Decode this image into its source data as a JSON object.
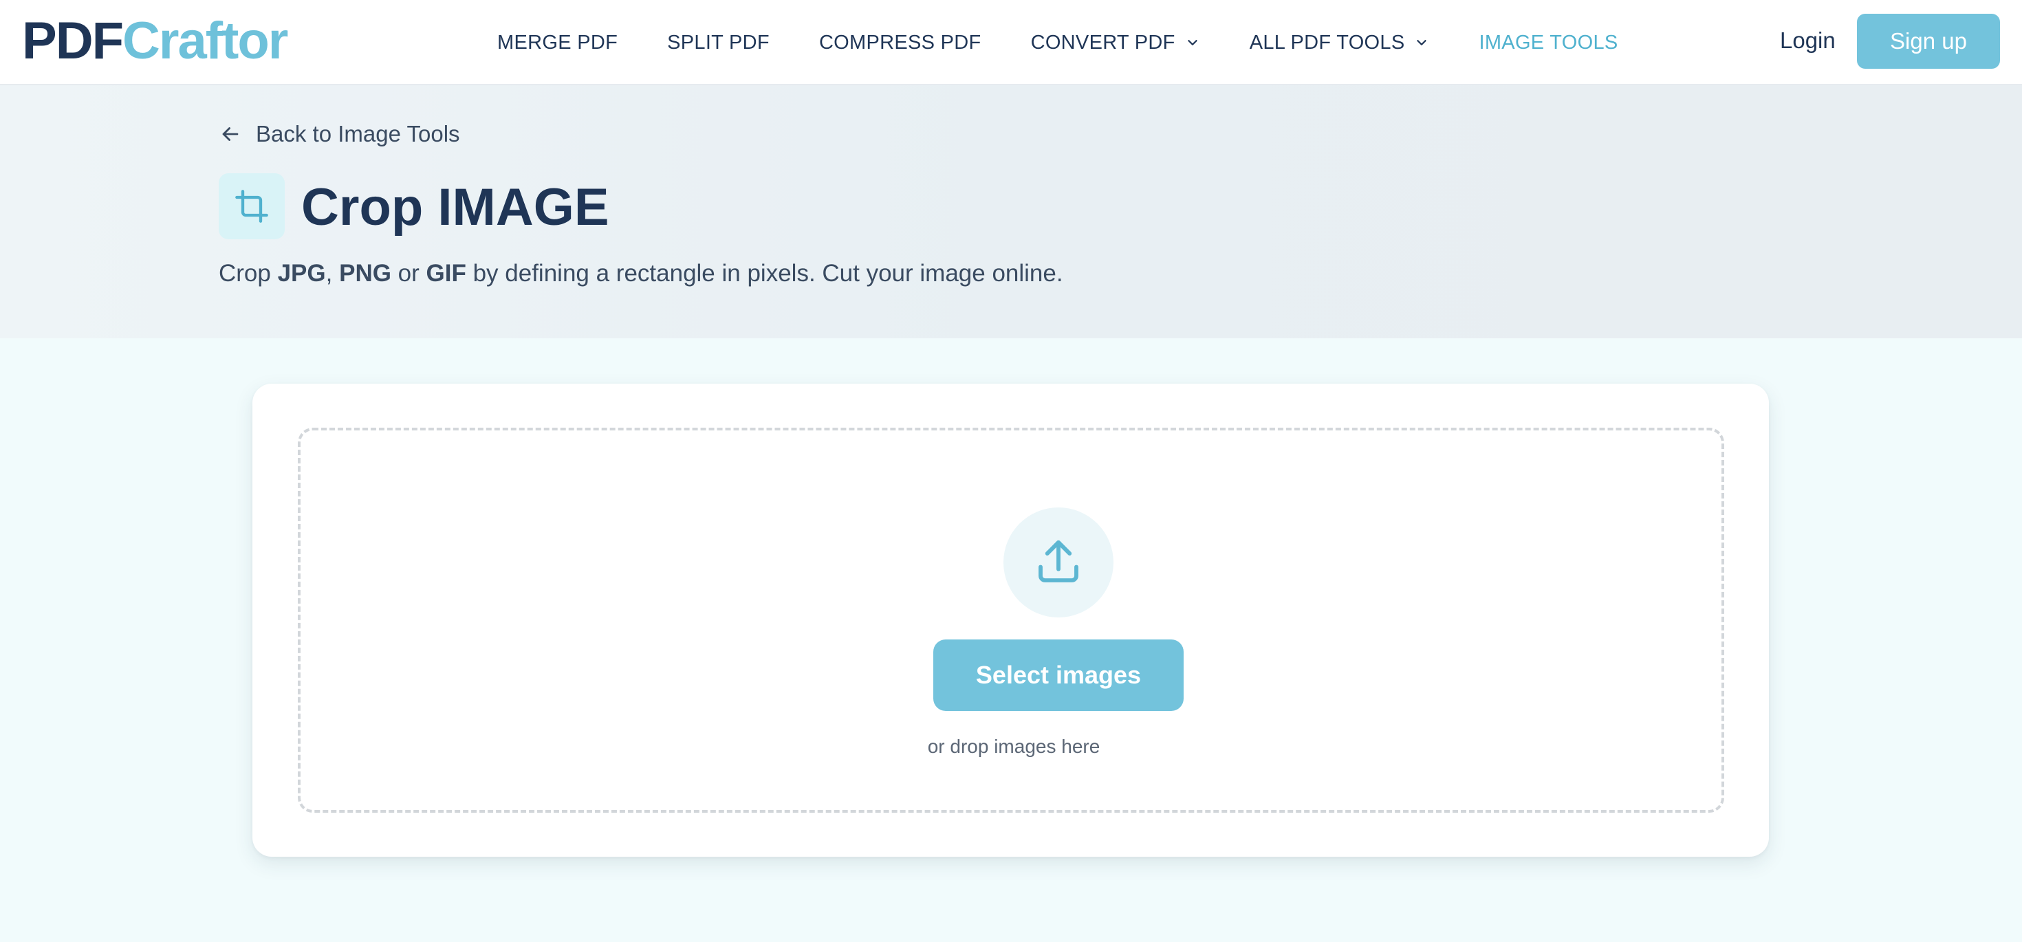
{
  "header": {
    "logo_part1": "PDF",
    "logo_part2": "Craftor",
    "nav": [
      {
        "label": "MERGE PDF",
        "dropdown": false,
        "active": false
      },
      {
        "label": "SPLIT PDF",
        "dropdown": false,
        "active": false
      },
      {
        "label": "COMPRESS PDF",
        "dropdown": false,
        "active": false
      },
      {
        "label": "CONVERT PDF",
        "dropdown": true,
        "active": false
      },
      {
        "label": "ALL PDF TOOLS",
        "dropdown": true,
        "active": false
      },
      {
        "label": "IMAGE TOOLS",
        "dropdown": false,
        "active": true
      }
    ],
    "login_label": "Login",
    "signup_label": "Sign up"
  },
  "hero": {
    "back_label": "Back to Image Tools",
    "back_icon": "arrow-left-icon",
    "tool_icon": "crop-icon",
    "title": "Crop IMAGE",
    "subtitle": {
      "prefix": "Crop ",
      "fmt1": "JPG",
      "sep1": ", ",
      "fmt2": "PNG",
      "sep2": " or ",
      "fmt3": "GIF",
      "suffix": " by defining a rectangle in pixels. Cut your image online."
    }
  },
  "upload": {
    "icon": "upload-icon",
    "button_label": "Select images",
    "hint": "or drop images here"
  },
  "colors": {
    "brand_dark": "#1f3556",
    "brand_accent": "#73c3dc",
    "active_nav": "#4fb1ce"
  }
}
